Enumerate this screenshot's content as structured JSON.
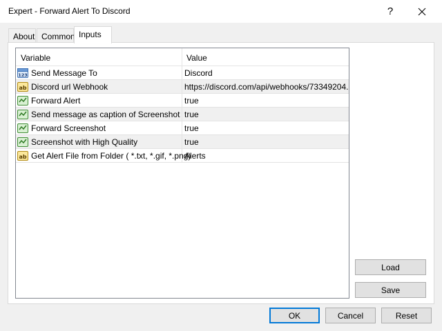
{
  "window": {
    "title": "Expert - Forward Alert To Discord",
    "help_label": "?"
  },
  "tabs": [
    {
      "label": "About"
    },
    {
      "label": "Common"
    },
    {
      "label": "Inputs",
      "active": true
    }
  ],
  "grid": {
    "columns": {
      "variable": "Variable",
      "value": "Value"
    },
    "rows": [
      {
        "icon": "number-icon",
        "variable": "Send Message To",
        "value": "Discord"
      },
      {
        "icon": "text-icon",
        "variable": "Discord url Webhook",
        "value": "https://discord.com/api/webhooks/73349204..."
      },
      {
        "icon": "boolean-icon",
        "variable": "Forward Alert",
        "value": "true"
      },
      {
        "icon": "boolean-icon",
        "variable": "Send message as caption of Screenshot",
        "value": "true"
      },
      {
        "icon": "boolean-icon",
        "variable": "Forward Screenshot",
        "value": "true"
      },
      {
        "icon": "boolean-icon",
        "variable": "Screenshot with High Quality",
        "value": "true"
      },
      {
        "icon": "text-icon",
        "variable": "Get Alert File from Folder ( *.txt, *.gif, *.png)",
        "value": "Alerts"
      }
    ]
  },
  "buttons": {
    "load": "Load",
    "save": "Save",
    "ok": "OK",
    "cancel": "Cancel",
    "reset": "Reset"
  },
  "colors": {
    "accent": "#0078d7",
    "window_bg": "#f0f0f0",
    "panel_bg": "#ffffff",
    "background": "#000000"
  }
}
